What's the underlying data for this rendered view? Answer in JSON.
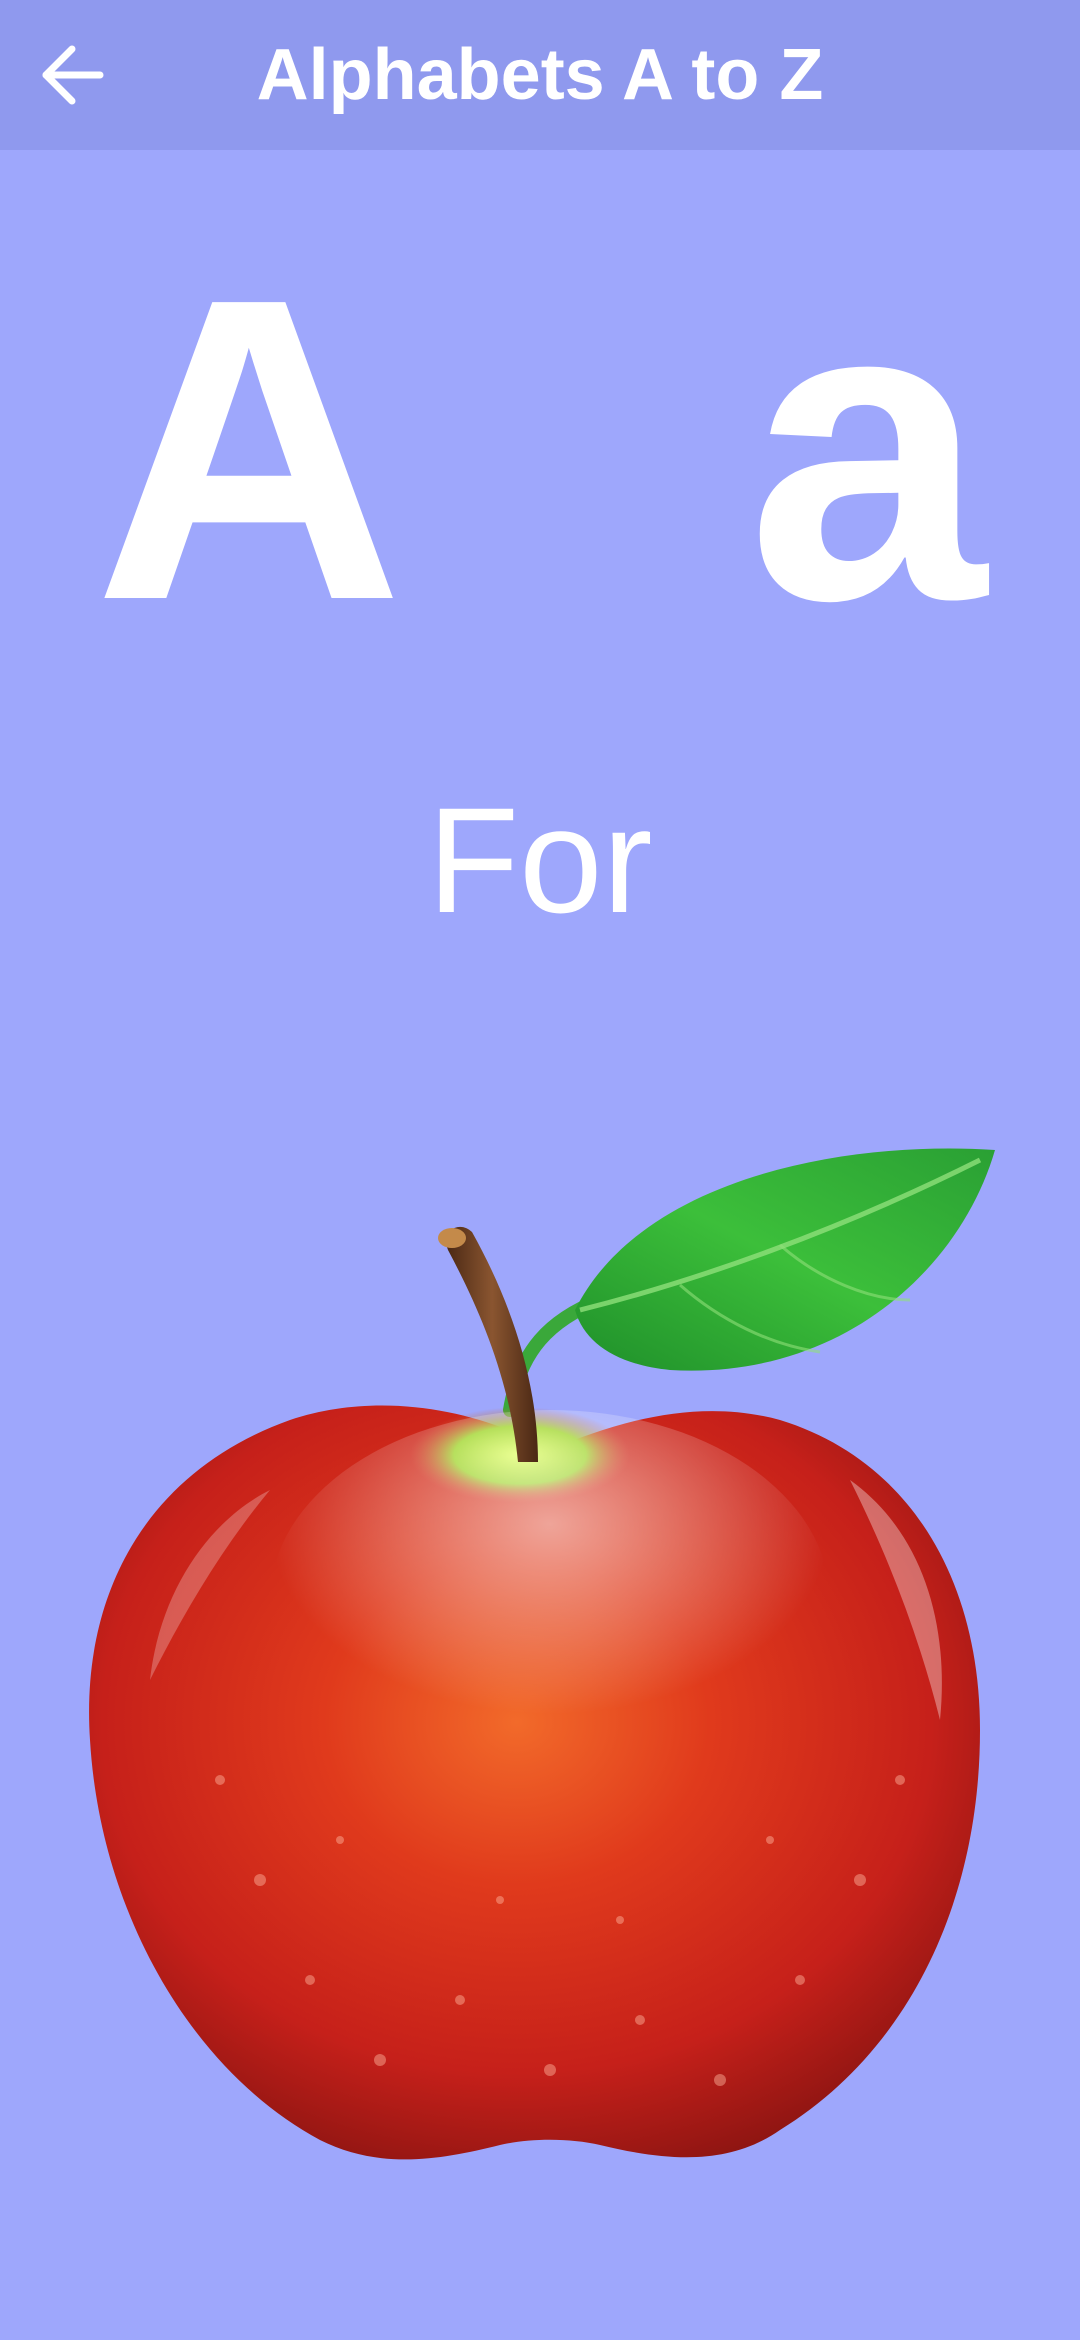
{
  "app": {
    "title": "Alphabets A to Z",
    "back_icon": "arrow-left-icon"
  },
  "card": {
    "upper_letter": "A",
    "lower_letter": "a",
    "connector": "For",
    "image_icon": "apple-icon"
  },
  "colors": {
    "background": "#9ea7fc",
    "app_bar": "#8f99ee",
    "text": "#ffffff",
    "apple_red": "#d8261b",
    "leaf_green": "#2fa830",
    "stem_brown": "#6b3a1e"
  }
}
